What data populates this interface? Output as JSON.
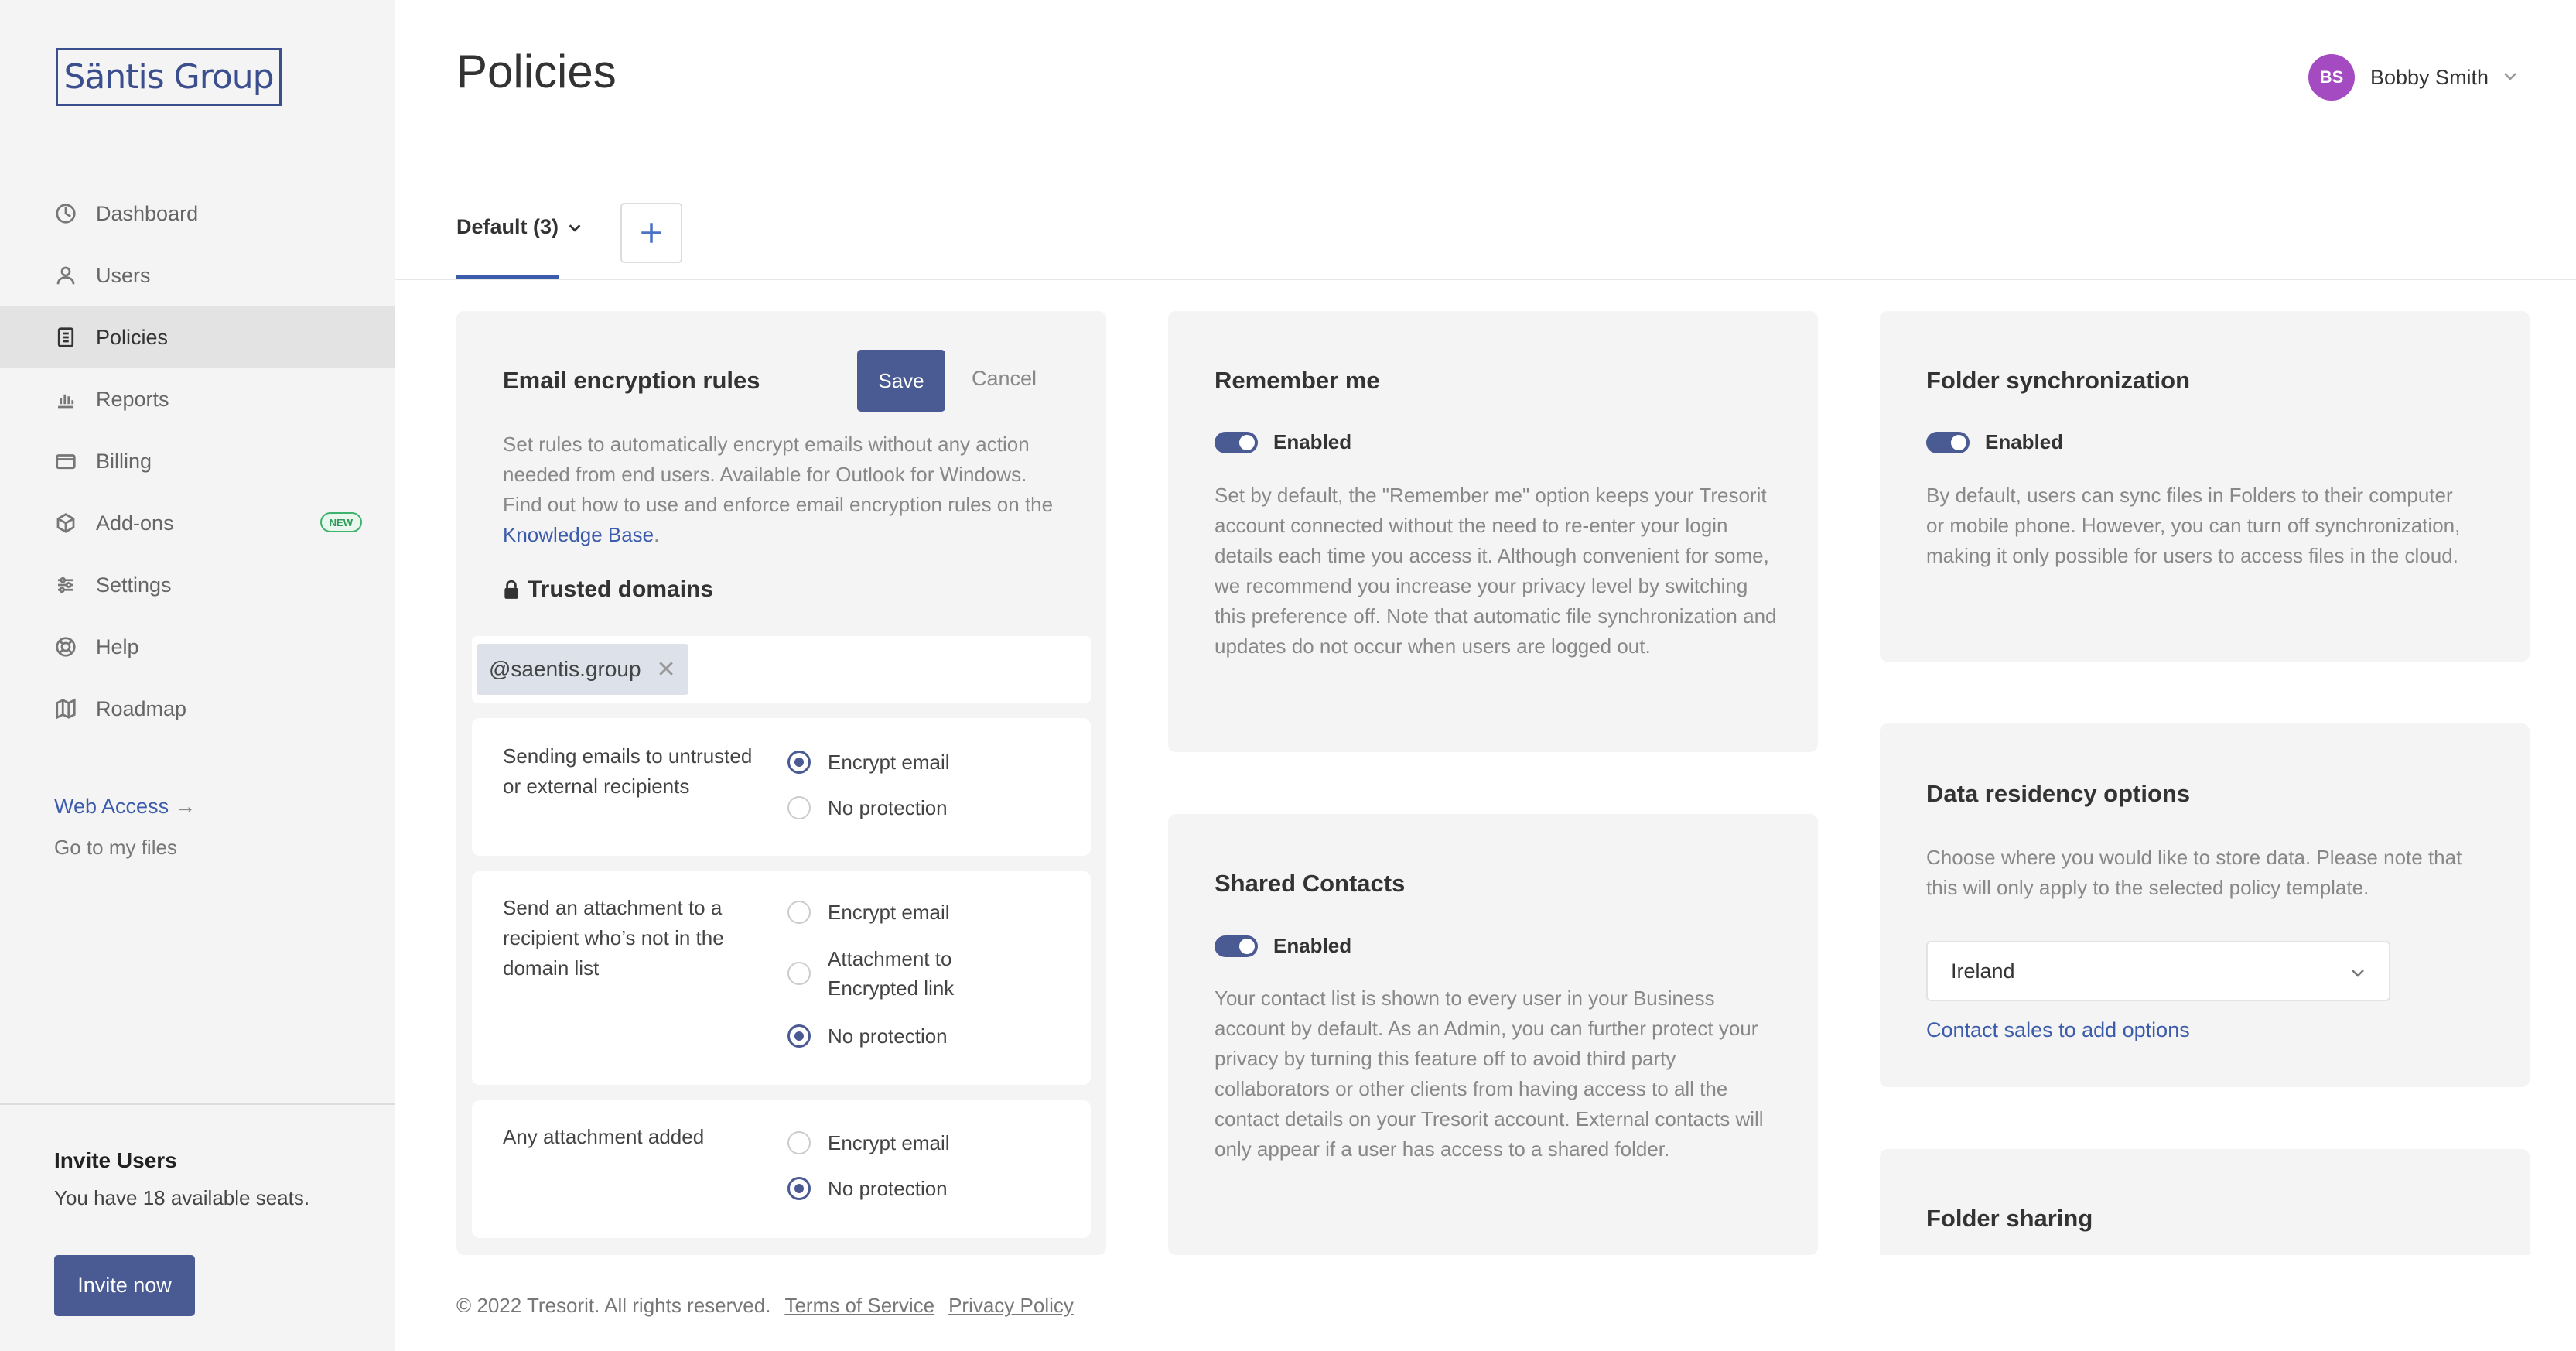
{
  "brand": {
    "logo_text": "Säntis Group",
    "accent": "#4a5b94",
    "link": "#3b5bab"
  },
  "sidebar": {
    "items": [
      {
        "label": "Dashboard",
        "icon": "dashboard-icon"
      },
      {
        "label": "Users",
        "icon": "user-icon"
      },
      {
        "label": "Policies",
        "icon": "policies-icon",
        "active": true
      },
      {
        "label": "Reports",
        "icon": "reports-icon"
      },
      {
        "label": "Billing",
        "icon": "billing-icon"
      },
      {
        "label": "Add-ons",
        "icon": "box-icon",
        "badge": "NEW"
      },
      {
        "label": "Settings",
        "icon": "settings-icon"
      },
      {
        "label": "Help",
        "icon": "help-icon"
      },
      {
        "label": "Roadmap",
        "icon": "map-icon"
      }
    ],
    "web_access": "Web Access",
    "web_access_arrow": "→",
    "go_files": "Go to my files",
    "invite_title": "Invite Users",
    "invite_text": "You have 18 available seats.",
    "invite_button": "Invite now"
  },
  "header": {
    "title": "Policies",
    "user_initials": "BS",
    "user_name": "Bobby Smith"
  },
  "tabs": {
    "default_label": "Default (3)"
  },
  "email_rules": {
    "title": "Email encryption rules",
    "save": "Save",
    "cancel": "Cancel",
    "desc_pre": "Set rules to automatically encrypt emails without any action needed from end users. Available for Outlook for Windows. Find out how to use and enforce email encryption rules on the ",
    "desc_link": "Knowledge Base",
    "desc_post": ".",
    "trusted_title": "Trusted domains",
    "domain_chip": "@saentis.group",
    "chip_remove": "✕",
    "rules": [
      {
        "label": "Sending emails to untrusted or external recipients",
        "options": [
          {
            "label": "Encrypt email",
            "selected": true
          },
          {
            "label": "No protection",
            "selected": false
          }
        ]
      },
      {
        "label": "Send an attachment to a recipient who’s not in the domain list",
        "options": [
          {
            "label": "Encrypt email",
            "selected": false
          },
          {
            "label": "Attachment to Encrypted link",
            "selected": false
          },
          {
            "label": "No protection",
            "selected": true
          }
        ]
      },
      {
        "label": "Any attachment added",
        "options": [
          {
            "label": "Encrypt email",
            "selected": false
          },
          {
            "label": "No protection",
            "selected": true
          }
        ]
      }
    ]
  },
  "remember_me": {
    "title": "Remember me",
    "toggle_label": "Enabled",
    "enabled": true,
    "desc": "Set by default, the \"Remember me\" option keeps your Tresorit account connected without the need to re-enter your login details each time you access it. Although convenient for some, we recommend you increase your privacy level by switching this preference off. Note that automatic file synchronization and updates do not occur when users are logged out."
  },
  "shared_contacts": {
    "title": "Shared Contacts",
    "toggle_label": "Enabled",
    "enabled": true,
    "desc": "Your contact list is shown to every user in your Business account by default. As an Admin, you can further protect your privacy by turning this feature off to avoid third party collaborators or other clients from having access to all the contact details on your Tresorit account. External contacts will only appear if a user has access to a shared folder."
  },
  "folder_sync": {
    "title": "Folder synchronization",
    "toggle_label": "Enabled",
    "enabled": true,
    "desc": "By default, users can sync files in Folders to their computer or mobile phone. However, you can turn off synchronization, making it only possible for users to access files in the cloud."
  },
  "data_residency": {
    "title": "Data residency options",
    "desc": "Choose where you would like to store data. Please note that this will only apply to the selected policy template.",
    "selected": "Ireland",
    "contact_link": "Contact sales to add options"
  },
  "folder_sharing": {
    "title": "Folder sharing"
  },
  "footer": {
    "copyright": "© 2022 Tresorit. All rights reserved.",
    "terms": "Terms of Service",
    "privacy": "Privacy Policy"
  }
}
